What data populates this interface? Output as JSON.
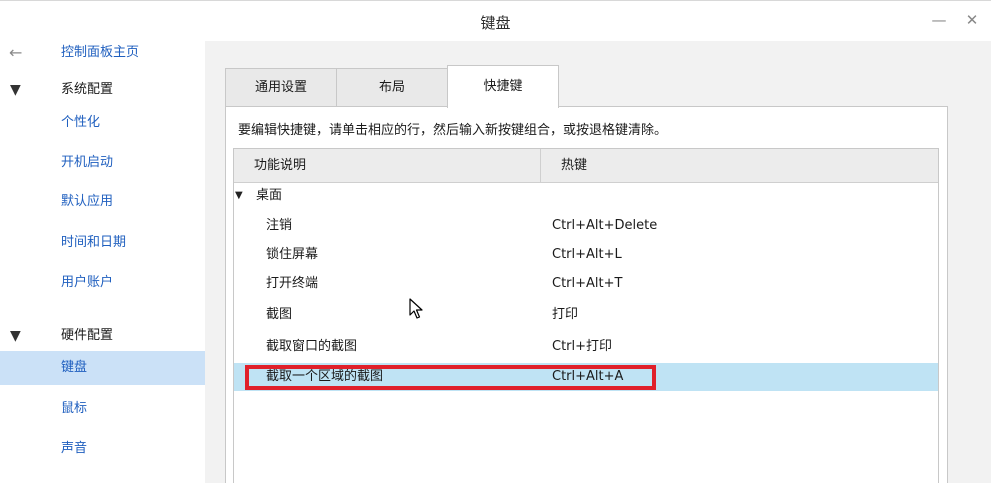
{
  "window": {
    "title": "键盘"
  },
  "titlebar": {
    "minimize_glyph": "—",
    "close_glyph": "✕"
  },
  "sidebar": {
    "back_label": "控制面板主页",
    "sections": [
      {
        "label": "系统配置",
        "items": [
          "个性化",
          "开机启动",
          "默认应用",
          "时间和日期",
          "用户账户"
        ]
      },
      {
        "label": "硬件配置",
        "items": [
          "键盘",
          "鼠标",
          "声音"
        ]
      }
    ],
    "selected": "键盘"
  },
  "tabs": [
    "通用设置",
    "布局",
    "快捷键"
  ],
  "active_tab": "快捷键",
  "instruction": "要编辑快捷键，请单击相应的行，然后输入新按键组合，或按退格键清除。",
  "table": {
    "columns": [
      "功能说明",
      "热键"
    ],
    "group": "桌面",
    "rows": [
      {
        "name": "注销",
        "hotkey": "Ctrl+Alt+Delete"
      },
      {
        "name": "锁住屏幕",
        "hotkey": "Ctrl+Alt+L"
      },
      {
        "name": "打开终端",
        "hotkey": "Ctrl+Alt+T"
      },
      {
        "name": "截图",
        "hotkey": "打印"
      },
      {
        "name": "截取窗口的截图",
        "hotkey": "Ctrl+打印"
      },
      {
        "name": "截取一个区域的截图",
        "hotkey": "Ctrl+Alt+A"
      }
    ],
    "selected_row": "截取一个区域的截图"
  },
  "colors": {
    "link": "#1f5fbf",
    "selection": "#bfe3f4",
    "sidebar_selection": "#cbe1f7",
    "highlight": "#e0202a"
  }
}
